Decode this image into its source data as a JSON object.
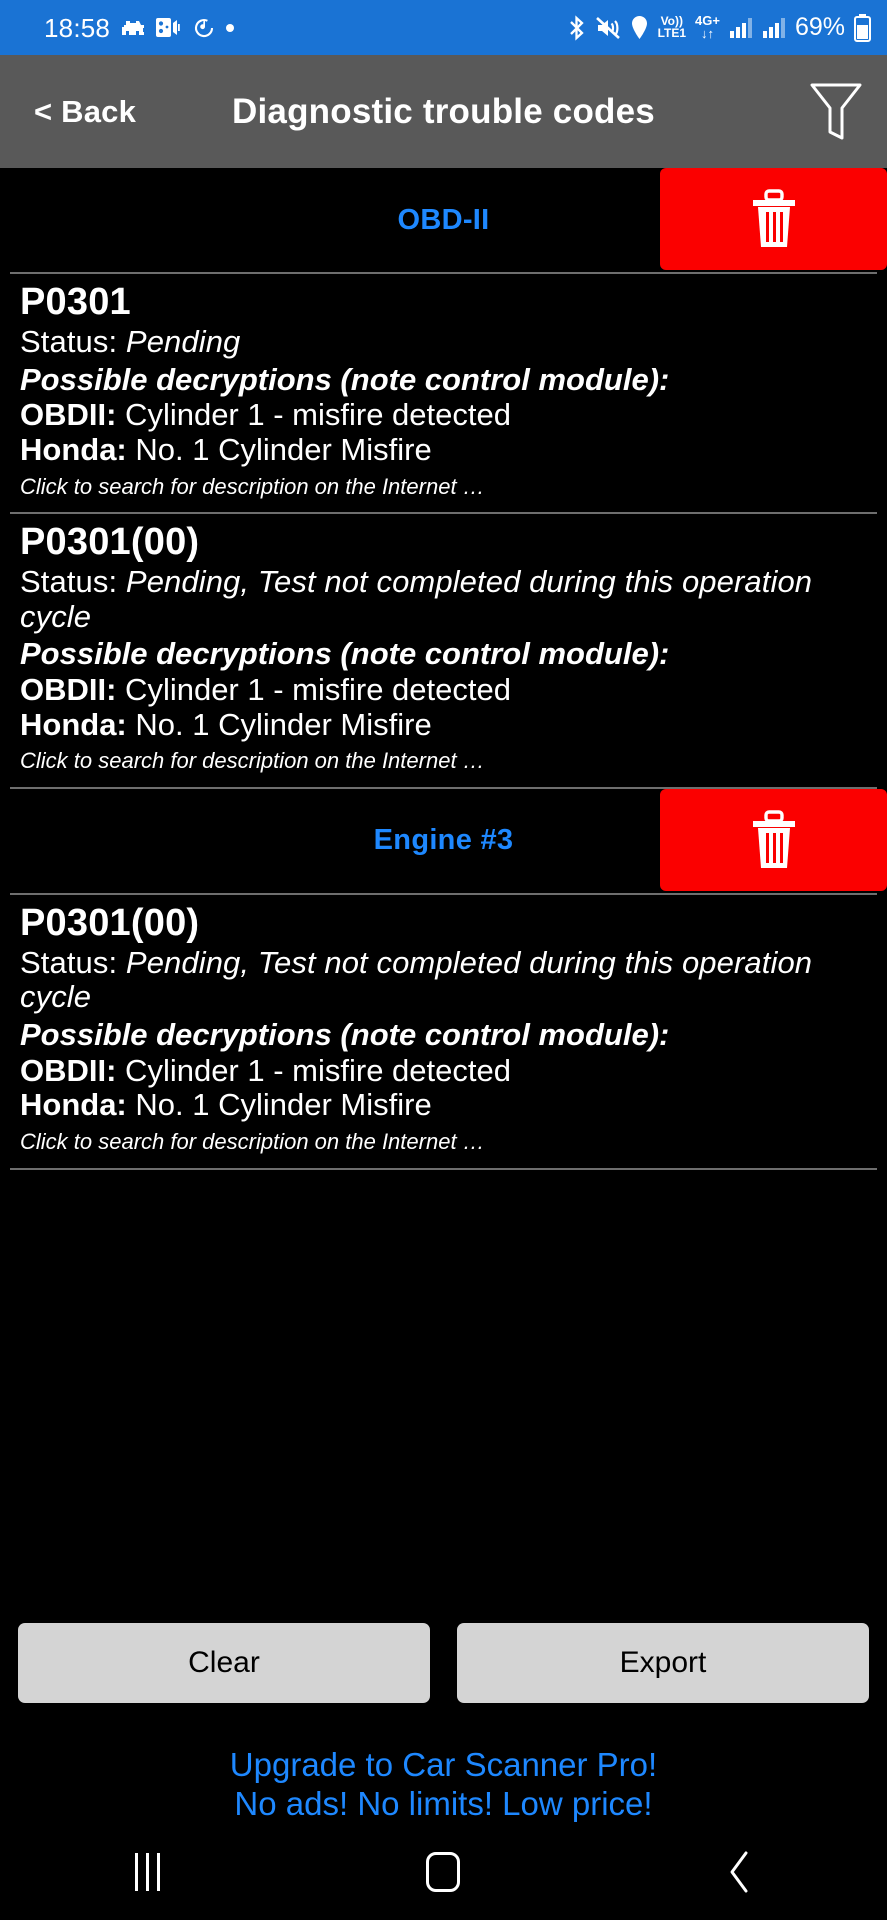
{
  "status_bar": {
    "time": "18:58",
    "left_icons": [
      "engine-check-icon",
      "obd-adapter-icon",
      "music-note-icon",
      "dot-indicator-icon"
    ],
    "right_icons": [
      "bluetooth-icon",
      "sound-muted-icon",
      "location-pin-icon"
    ],
    "volte_top": "Vo))",
    "volte_bottom": "LTE1",
    "network_type": "4G+",
    "network_arrows": "↓↑",
    "battery_percent": "69%"
  },
  "header": {
    "back_label": "< Back",
    "title": "Diagnostic trouble codes",
    "filter_icon": "filter-funnel-icon"
  },
  "groups": [
    {
      "name": "OBD-II",
      "delete_icon": "trash-icon",
      "codes": [
        {
          "code": "P0301",
          "status_label": "Status: ",
          "status_value": "Pending",
          "decryptions_label": "Possible decryptions (note control module):",
          "definitions": [
            {
              "maker": "OBDII:",
              "text": " Cylinder 1 - misfire detected"
            },
            {
              "maker": "Honda:",
              "text": " No. 1 Cylinder Misfire"
            }
          ],
          "hint": "Click to search for description on the Internet …"
        },
        {
          "code": "P0301(00)",
          "status_label": "Status: ",
          "status_value": "Pending, Test not completed during this operation cycle",
          "decryptions_label": "Possible decryptions (note control module):",
          "definitions": [
            {
              "maker": "OBDII:",
              "text": " Cylinder 1 - misfire detected"
            },
            {
              "maker": "Honda:",
              "text": " No. 1 Cylinder Misfire"
            }
          ],
          "hint": "Click to search for description on the Internet …"
        }
      ]
    },
    {
      "name": "Engine #3",
      "delete_icon": "trash-icon",
      "codes": [
        {
          "code": "P0301(00)",
          "status_label": "Status: ",
          "status_value": "Pending, Test not completed during this operation cycle",
          "decryptions_label": "Possible decryptions (note control module):",
          "definitions": [
            {
              "maker": "OBDII:",
              "text": " Cylinder 1 - misfire detected"
            },
            {
              "maker": "Honda:",
              "text": " No. 1 Cylinder Misfire"
            }
          ],
          "hint": "Click to search for description on the Internet …"
        }
      ]
    }
  ],
  "actions": {
    "clear_label": "Clear",
    "export_label": "Export"
  },
  "promo": {
    "line1": "Upgrade to Car Scanner Pro!",
    "line2": "No ads! No limits! Low price!"
  },
  "navbar": {
    "recents": "recents-icon",
    "home": "home-icon",
    "back": "back-chevron-icon"
  },
  "colors": {
    "status_bar_bg": "#1a73d4",
    "header_bg": "#595959",
    "accent_blue": "#1e88ff",
    "delete_red": "#fb0000",
    "button_gray": "#d4d4d4",
    "divider": "#6e6e6e",
    "page_bg": "#000000"
  }
}
